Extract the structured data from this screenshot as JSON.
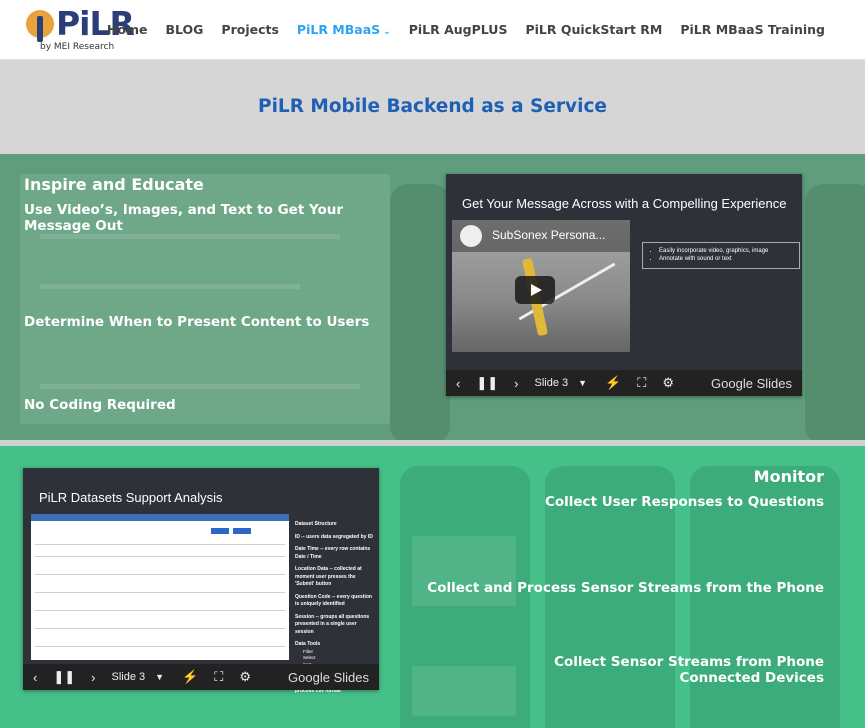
{
  "header": {
    "logo_text": "PiLR",
    "logo_tagline": "by MEI Research",
    "nav": [
      {
        "label": "Home",
        "active": false
      },
      {
        "label": "BLOG",
        "active": false
      },
      {
        "label": "Projects",
        "active": false
      },
      {
        "label": "PiLR MBaaS",
        "active": true,
        "has_dropdown": true
      },
      {
        "label": "PiLR AugPLUS",
        "active": false
      },
      {
        "label": "PiLR QuickStart RM",
        "active": false
      },
      {
        "label": "PiLR MBaaS Training",
        "active": false
      }
    ],
    "dropdown_glyph": "⌄"
  },
  "title_band": {
    "title": "PiLR Mobile Backend as a Service"
  },
  "section1": {
    "headings": [
      "Inspire and Educate",
      "Use Video’s, Images, and Text to Get Your Message Out",
      "Determine When to Present Content to Users",
      "No Coding Required"
    ],
    "embed": {
      "slide_title": "Get Your Message Across with a Compelling Experience",
      "video_title": "SubSonex Persona...",
      "bullets": [
        "Easily incorporate video, graphics, image",
        "Annotate with sound or text"
      ],
      "controls": {
        "prev": "‹",
        "pause": "❚❚",
        "next": "›",
        "slide_label": "Slide 3",
        "caret": "▼",
        "laser": "⚡",
        "fullscreen": "⛶",
        "settings": "⚙",
        "brand": "Google Slides"
      }
    }
  },
  "section2": {
    "headings": [
      "Monitor",
      "Collect User Responses to Questions",
      "Collect and Process Sensor Streams from the Phone",
      "Collect Sensor Streams from Phone Connected Devices"
    ],
    "embed": {
      "slide_title": "PiLR Datasets Support Analysis",
      "notes": {
        "title": "Dataset Structure",
        "items": [
          "ID -- users data segregated by ID",
          "Date Time -- every row contains Date / Time",
          "Location Data -- collected at moment user presses the 'Submit' button",
          "Question Code -- every question is uniquely identified",
          "Session -- groups all questions presented in a single user session",
          "Data Tools",
          "Downloaded data is in easy to process csv format"
        ],
        "tools": [
          "Filter",
          "Select",
          "Sort",
          "Download"
        ]
      },
      "controls": {
        "prev": "‹",
        "pause": "❚❚",
        "next": "›",
        "slide_label": "Slide 3",
        "caret": "▼",
        "laser": "⚡",
        "fullscreen": "⛶",
        "settings": "⚙",
        "brand": "Google Slides"
      }
    }
  },
  "colors": {
    "brand_navy": "#2c3e78",
    "brand_orange": "#e8a33a",
    "nav_active": "#2ea3f2",
    "title_blue": "#1f5fb4",
    "section1_bg": "#5f9d7c",
    "section2_bg": "#45c089"
  }
}
